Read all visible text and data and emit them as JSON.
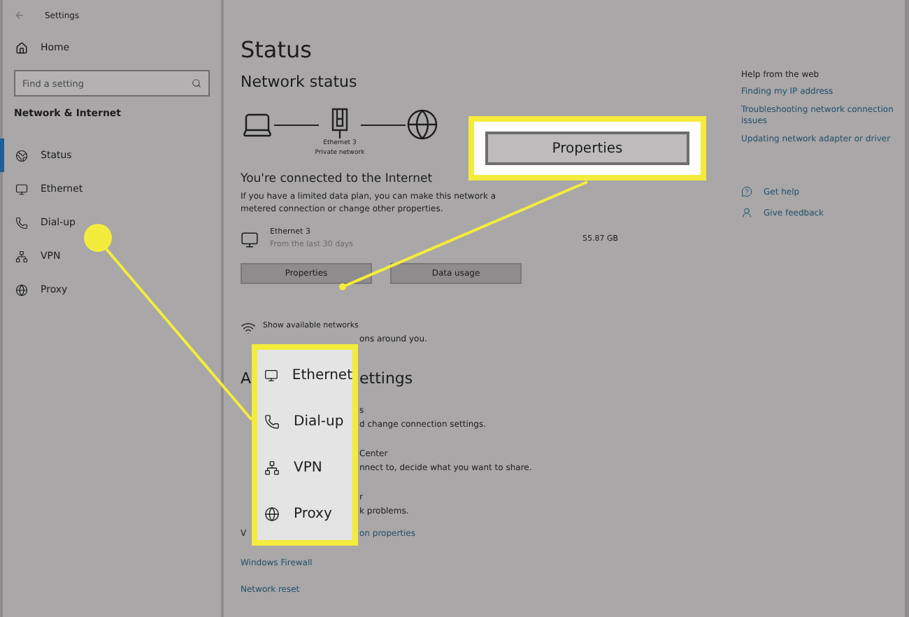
{
  "window": {
    "title": "Settings"
  },
  "sidebar": {
    "home": "Home",
    "search": {
      "placeholder": "Find a setting"
    },
    "section": "Network & Internet",
    "items": [
      {
        "label": "Status",
        "kind": "status",
        "selected": true
      },
      {
        "label": "Ethernet",
        "kind": "ethernet",
        "selected": false
      },
      {
        "label": "Dial-up",
        "kind": "dialup",
        "selected": false
      },
      {
        "label": "VPN",
        "kind": "vpn",
        "selected": false
      },
      {
        "label": "Proxy",
        "kind": "proxy",
        "selected": false
      }
    ]
  },
  "main": {
    "title": "Status",
    "network_status": {
      "heading": "Network status",
      "adapter": "Ethernet 3",
      "network_type": "Private network"
    },
    "connected": {
      "heading": "You're connected to the Internet",
      "description": "If you have a limited data plan, you can make this network a metered connection or change other properties."
    },
    "usage": {
      "name": "Ethernet 3",
      "period": "From the last 30 days",
      "amount": "55.87 GB"
    },
    "buttons": [
      "Properties",
      "Data usage"
    ],
    "show_networks": {
      "title": "Show available networks",
      "subtitle": "ons around you."
    },
    "partial_rows": [
      {
        "kind": "heading",
        "left": "A",
        "right": "ettings"
      },
      {
        "kind": "title",
        "right": "s"
      },
      {
        "kind": "subtitle",
        "right": "d change connection settings."
      },
      {
        "kind": "title",
        "right": "Center"
      },
      {
        "kind": "subtitle",
        "right": "nnect to, decide what you want to share."
      },
      {
        "kind": "title",
        "right": "r"
      },
      {
        "kind": "subtitle",
        "right": "k problems."
      },
      {
        "kind": "link",
        "left": "V",
        "right": "on properties"
      }
    ],
    "links": [
      "Windows Firewall",
      "Network reset"
    ]
  },
  "help": {
    "heading": "Help from the web",
    "links": [
      "Finding my IP address",
      "Troubleshooting network connection issues",
      "Updating network adapter or driver"
    ],
    "actions": [
      {
        "label": "Get help",
        "kind": "help"
      },
      {
        "label": "Give feedback",
        "kind": "feedback"
      }
    ]
  },
  "callouts": {
    "button": "Properties",
    "menu": [
      {
        "label": "Ethernet",
        "kind": "ethernet"
      },
      {
        "label": "Dial-up",
        "kind": "dialup"
      },
      {
        "label": "VPN",
        "kind": "vpn"
      },
      {
        "label": "Proxy",
        "kind": "proxy"
      }
    ]
  }
}
